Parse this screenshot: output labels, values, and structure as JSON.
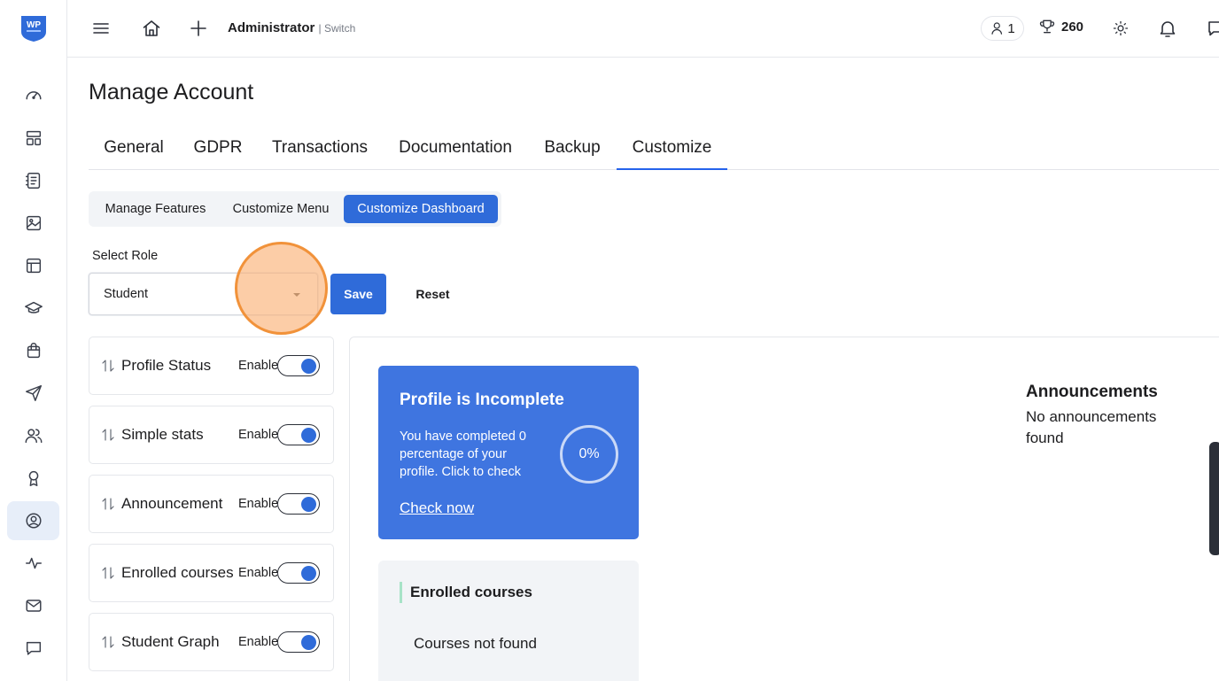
{
  "header": {
    "logo_text": "WP",
    "user_name": "Administrator",
    "switch_label": "| Switch",
    "online_count": "1",
    "points": "260"
  },
  "page": {
    "title": "Manage Account"
  },
  "tabs": [
    {
      "label": "General"
    },
    {
      "label": "GDPR"
    },
    {
      "label": "Transactions"
    },
    {
      "label": "Documentation"
    },
    {
      "label": "Backup"
    },
    {
      "label": "Customize"
    }
  ],
  "subtabs": [
    {
      "label": "Manage Features"
    },
    {
      "label": "Customize Menu"
    },
    {
      "label": "Customize Dashboard"
    }
  ],
  "role": {
    "label": "Select Role",
    "value": "Student",
    "save_label": "Save",
    "reset_label": "Reset"
  },
  "features": [
    {
      "name": "Profile Status",
      "state": "Enable"
    },
    {
      "name": "Simple stats",
      "state": "Enable"
    },
    {
      "name": "Announcement",
      "state": "Enable"
    },
    {
      "name": "Enrolled courses",
      "state": "Enable"
    },
    {
      "name": "Student Graph",
      "state": "Enable"
    }
  ],
  "profile_card": {
    "title": "Profile is Incomplete",
    "text": "You have completed 0 percentage of your profile. Click to check",
    "link": "Check now",
    "percent": "0%"
  },
  "enrolled_card": {
    "title": "Enrolled courses",
    "empty": "Courses not found"
  },
  "announcements": {
    "title": "Announcements",
    "empty": "No announcements found"
  },
  "colors": {
    "primary": "#2f6bd9",
    "card_blue": "#3f75e0",
    "highlight": "#f1923a"
  }
}
